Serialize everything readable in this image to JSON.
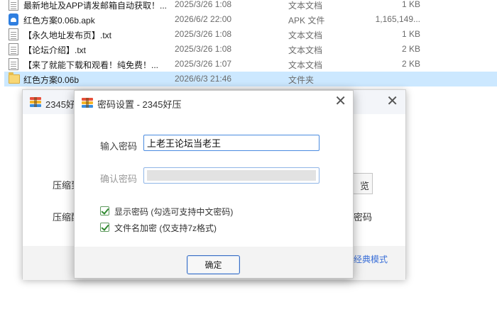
{
  "files": [
    {
      "name": "最新地址及APP请发邮箱自动获取！...",
      "date": "2025/3/26 1:08",
      "type": "文本文档",
      "size": "1 KB",
      "icon": "text-file-icon"
    },
    {
      "name": "红色方案0.06b.apk",
      "date": "2026/6/2 22:00",
      "type": "APK 文件",
      "size": "1,165,149...",
      "icon": "apk-file-icon"
    },
    {
      "name": "【永久地址发布页】.txt",
      "date": "2025/3/26 1:08",
      "type": "文本文档",
      "size": "1 KB",
      "icon": "text-file-icon"
    },
    {
      "name": "【论坛介绍】.txt",
      "date": "2025/3/26 1:08",
      "type": "文本文档",
      "size": "2 KB",
      "icon": "text-file-icon"
    },
    {
      "name": "【来了就能下载和观看！纯免费！...",
      "date": "2025/3/26 1:07",
      "type": "文本文档",
      "size": "2 KB",
      "icon": "text-file-icon"
    },
    {
      "name": "红色方案0.06b",
      "date": "2026/6/3 21:46",
      "type": "文件夹",
      "size": "",
      "icon": "folder-icon",
      "selected": true
    }
  ],
  "back_window": {
    "title": "2345好",
    "label_1": "压缩到",
    "label_2": "压缩配",
    "side_button": "浏览",
    "side_label": "密码",
    "classic_link": "经典模式"
  },
  "dialog": {
    "title": "密码设置 - 2345好压",
    "password_label": "输入密码",
    "password_value": "上老王论坛当老王",
    "confirm_label": "确认密码",
    "show_password_label": "显示密码 (勾选可支持中文密码)",
    "show_password_checked": true,
    "encrypt_names_label": "文件名加密 (仅支持7z格式)",
    "encrypt_names_checked": true,
    "ok_label": "确定"
  },
  "colors": {
    "selection": "#cce8ff",
    "link": "#3a6fd8",
    "checkbox": "#2f8a2f",
    "focus_border": "#4a8be0"
  }
}
